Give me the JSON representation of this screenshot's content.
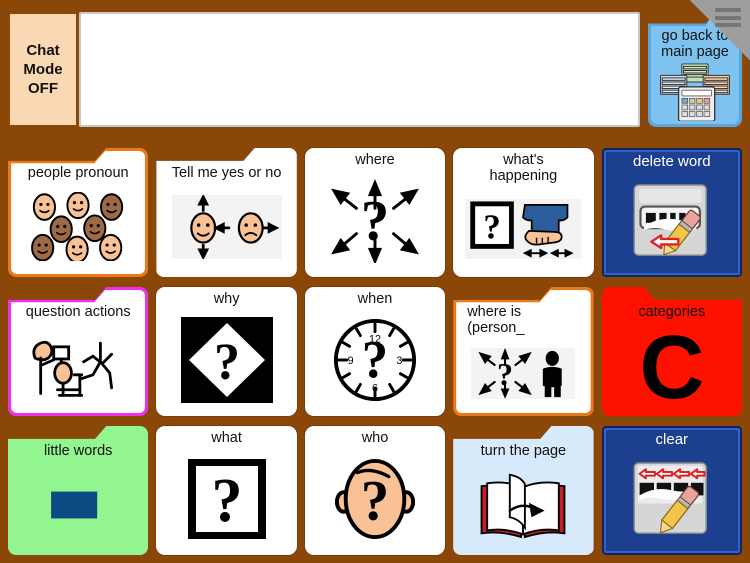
{
  "app": {
    "background_color": "#8a4708",
    "menu_icon": "hamburger-icon"
  },
  "topbar": {
    "chat_mode_label": "Chat\nMode\nOFF",
    "chat_mode_line1": "Chat",
    "chat_mode_line2": "Mode",
    "chat_mode_line3": "OFF",
    "chat_mode_bg": "#fbd8b4",
    "message_window_value": "",
    "message_window_placeholder": "",
    "go_back": {
      "label_line1": "go back to",
      "label_line2": "main page",
      "color": "#7ec3f0",
      "icon": "calculator-grid-icon"
    }
  },
  "grid": {
    "rows": 3,
    "columns": 5,
    "cells": [
      {
        "id": "people-pronoun",
        "label": "people pronoun",
        "type": "folder",
        "tab": "right",
        "border_color": "#ea7a18",
        "bg": "#ffffff",
        "icon": "eight-faces-icon"
      },
      {
        "id": "tell-me-yes-or-no",
        "label": "Tell me yes or no",
        "type": "folder",
        "tab": "right",
        "border_color": "#ffffff",
        "bg": "#ffffff",
        "icon": "two-faces-arrows-icon"
      },
      {
        "id": "where",
        "label": "where",
        "type": "card",
        "bg": "#ffffff",
        "icon": "question-mark-arrows-icon"
      },
      {
        "id": "whats-happening",
        "label": "what's happening",
        "label_line1": "what's",
        "label_line2": "happening",
        "type": "card",
        "bg": "#ffffff",
        "icon": "question-box-and-hands-icon"
      },
      {
        "id": "delete-word",
        "label": "delete word",
        "type": "action",
        "bg": "#1d3f8f",
        "text_color": "#ffffff",
        "icon": "eraser-delete-icon"
      },
      {
        "id": "question-actions",
        "label": "question actions",
        "type": "folder",
        "tab": "right",
        "border_color": "#ee30ee",
        "bg": "#ffffff",
        "icon": "people-actions-icon"
      },
      {
        "id": "why",
        "label": "why",
        "type": "card",
        "bg": "#ffffff",
        "icon": "black-square-diamond-question-icon"
      },
      {
        "id": "when",
        "label": "when",
        "type": "card",
        "bg": "#ffffff",
        "icon": "clock-question-icon",
        "clock_numbers": [
          "12",
          "3",
          "6",
          "9"
        ]
      },
      {
        "id": "where-is-person",
        "label": "where is (person_",
        "label_line1": "where is",
        "label_line2": "(person_",
        "type": "folder",
        "tab": "right",
        "border_color": "#ea7a18",
        "bg": "#ffffff",
        "icon": "question-arrows-person-icon"
      },
      {
        "id": "categories",
        "label": "categories",
        "type": "folder",
        "tab": "left",
        "border_color": "#ff1100",
        "bg": "#ff1100",
        "icon": "letter-c-icon",
        "glyph": "C"
      },
      {
        "id": "little-words",
        "label": "little words",
        "type": "folder",
        "tab": "right",
        "border_color": "#93f58f",
        "bg": "#93f58f",
        "icon": "blue-rectangle-icon"
      },
      {
        "id": "what",
        "label": "what",
        "type": "card",
        "bg": "#ffffff",
        "icon": "question-box-icon"
      },
      {
        "id": "who",
        "label": "who",
        "type": "card",
        "bg": "#ffffff",
        "icon": "face-question-icon"
      },
      {
        "id": "turn-the-page",
        "label": "turn the page",
        "type": "folder",
        "tab": "right",
        "border_color": "#d6eafb",
        "bg": "#d6eafb",
        "icon": "open-book-arrow-icon"
      },
      {
        "id": "clear",
        "label": "clear",
        "type": "action",
        "bg": "#1d3f8f",
        "text_color": "#ffffff",
        "icon": "eraser-clear-arrows-icon"
      }
    ]
  }
}
